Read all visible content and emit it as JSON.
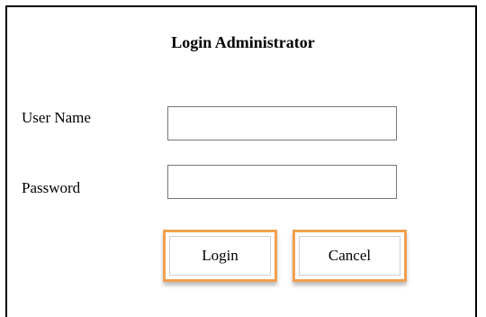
{
  "form": {
    "title": "Login Administrator",
    "username_label": "User Name",
    "password_label": "Password",
    "username_value": "",
    "password_value": ""
  },
  "buttons": {
    "login_label": "Login",
    "cancel_label": "Cancel"
  },
  "colors": {
    "button_border": "#f0a050",
    "frame_border": "#000000"
  }
}
